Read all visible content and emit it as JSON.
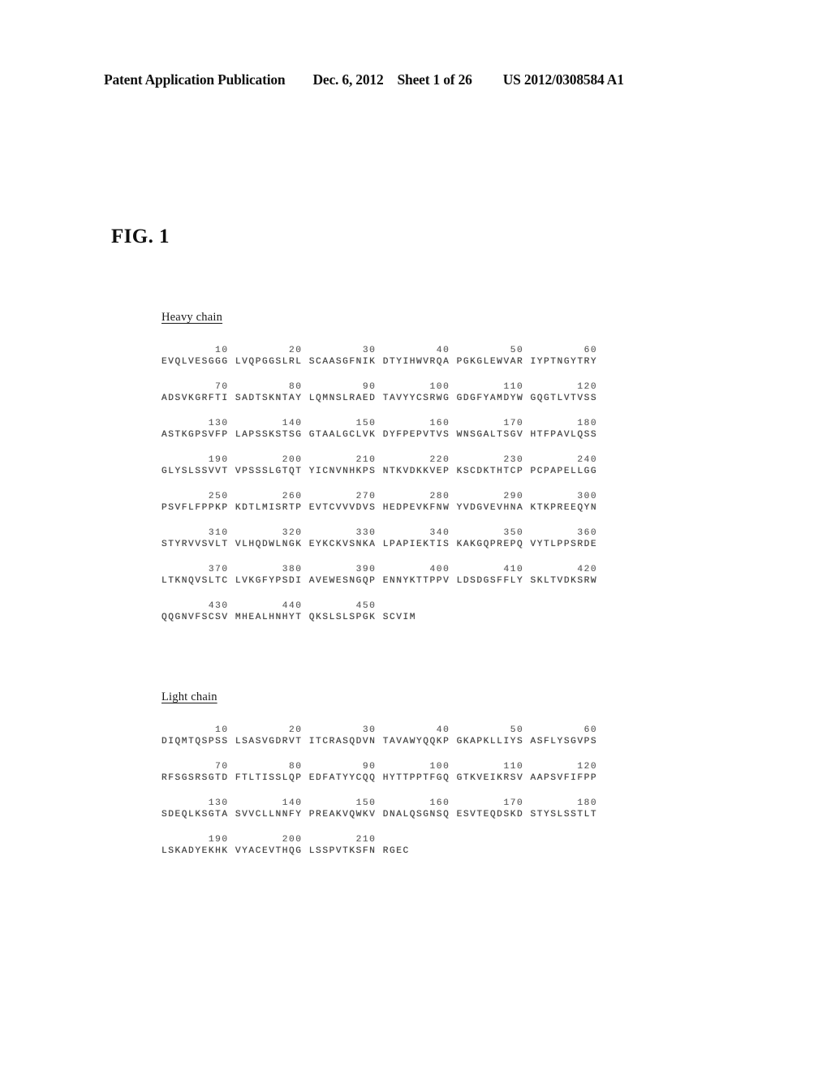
{
  "header": {
    "publication_label": "Patent Application Publication",
    "date": "Dec. 6, 2012",
    "sheet": "Sheet 1 of 26",
    "patent_number": "US 2012/0308584 A1"
  },
  "figure": {
    "label": "FIG. 1"
  },
  "heavy_chain": {
    "title": "Heavy chain",
    "block_size": 10,
    "blocks_per_row": 6,
    "rows": [
      {
        "numbers": [
          "10",
          "20",
          "30",
          "40",
          "50",
          "60"
        ],
        "blocks": [
          "EVQLVESGGG",
          "LVQPGGSLRL",
          "SCAASGFNIK",
          "DTYIHWVRQA",
          "PGKGLEWVAR",
          "IYPTNGYTRY"
        ]
      },
      {
        "numbers": [
          "70",
          "80",
          "90",
          "100",
          "110",
          "120"
        ],
        "blocks": [
          "ADSVKGRFTI",
          "SADTSKNTAY",
          "LQMNSLRAED",
          "TAVYYCSRWG",
          "GDGFYAMDYW",
          "GQGTLVTVSS"
        ]
      },
      {
        "numbers": [
          "130",
          "140",
          "150",
          "160",
          "170",
          "180"
        ],
        "blocks": [
          "ASTKGPSVFP",
          "LAPSSKSTSG",
          "GTAALGCLVK",
          "DYFPEPVTVS",
          "WNSGALTSGV",
          "HTFPAVLQSS"
        ]
      },
      {
        "numbers": [
          "190",
          "200",
          "210",
          "220",
          "230",
          "240"
        ],
        "blocks": [
          "GLYSLSSVVT",
          "VPSSSLGTQT",
          "YICNVNHKPS",
          "NTKVDKKVEP",
          "KSCDKTHTCP",
          "PCPAPELLGG"
        ]
      },
      {
        "numbers": [
          "250",
          "260",
          "270",
          "280",
          "290",
          "300"
        ],
        "blocks": [
          "PSVFLFPPKP",
          "KDTLMISRTP",
          "EVTCVVVDVS",
          "HEDPEVKFNW",
          "YVDGVEVHNA",
          "KTKPREEQYN"
        ]
      },
      {
        "numbers": [
          "310",
          "320",
          "330",
          "340",
          "350",
          "360"
        ],
        "blocks": [
          "STYRVVSVLT",
          "VLHQDWLNGK",
          "EYKCKVSNKA",
          "LPAPIEKTIS",
          "KAKGQPREPQ",
          "VYTLPPSRDE"
        ]
      },
      {
        "numbers": [
          "370",
          "380",
          "390",
          "400",
          "410",
          "420"
        ],
        "blocks": [
          "LTKNQVSLTC",
          "LVKGFYPSDI",
          "AVEWESNGQP",
          "ENNYKTTPPV",
          "LDSDGSFFLY",
          "SKLTVDKSRW"
        ]
      },
      {
        "numbers": [
          "430",
          "440",
          "450"
        ],
        "blocks": [
          "QQGNVFSCSV",
          "MHEALHNHYT",
          "QKSLSLSPGK",
          "SCVIM"
        ]
      }
    ]
  },
  "light_chain": {
    "title": "Light chain",
    "block_size": 10,
    "blocks_per_row": 6,
    "rows": [
      {
        "numbers": [
          "10",
          "20",
          "30",
          "40",
          "50",
          "60"
        ],
        "blocks": [
          "DIQMTQSPSS",
          "LSASVGDRVT",
          "ITCRASQDVN",
          "TAVAWYQQKP",
          "GKAPKLLIYS",
          "ASFLYSGVPS"
        ]
      },
      {
        "numbers": [
          "70",
          "80",
          "90",
          "100",
          "110",
          "120"
        ],
        "blocks": [
          "RFSGSRSGTD",
          "FTLTISSLQP",
          "EDFATYYCQQ",
          "HYTTPPTFGQ",
          "GTKVEIKRSV",
          "AAPSVFIFPP"
        ]
      },
      {
        "numbers": [
          "130",
          "140",
          "150",
          "160",
          "170",
          "180"
        ],
        "blocks": [
          "SDEQLKSGTA",
          "SVVCLLNNFY",
          "PREAKVQWKV",
          "DNALQSGNSQ",
          "ESVTEQDSKD",
          "STYSLSSTLT"
        ]
      },
      {
        "numbers": [
          "190",
          "200",
          "210"
        ],
        "blocks": [
          "LSKADYEKHK",
          "VYACEVTHQG",
          "LSSPVTKSFN",
          "RGEC"
        ]
      }
    ]
  }
}
